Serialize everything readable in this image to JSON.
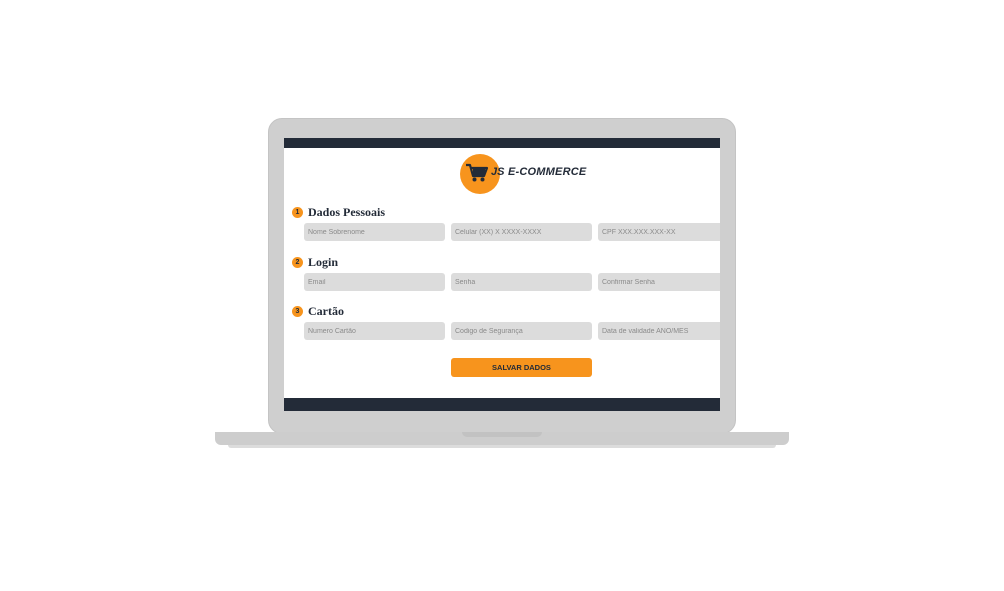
{
  "brand": {
    "js": "JS",
    "name": "E-COMMERCE"
  },
  "sections": [
    {
      "number": "1",
      "title": "Dados Pessoais",
      "fields": [
        {
          "placeholder": "Nome Sobrenome"
        },
        {
          "placeholder": "Celular (XX) X XXXX-XXXX"
        },
        {
          "placeholder": "CPF XXX.XXX.XXX-XX"
        }
      ]
    },
    {
      "number": "2",
      "title": "Login",
      "fields": [
        {
          "placeholder": "Email"
        },
        {
          "placeholder": "Senha"
        },
        {
          "placeholder": "Confirmar Senha"
        }
      ]
    },
    {
      "number": "3",
      "title": "Cartão",
      "fields": [
        {
          "placeholder": "Numero Cartão"
        },
        {
          "placeholder": "Codigo de Segurança"
        },
        {
          "placeholder": "Data de validade ANO/MES"
        }
      ]
    }
  ],
  "actions": {
    "save_label": "SALVAR DADOS"
  },
  "colors": {
    "accent": "#f7941d",
    "dark": "#232b38",
    "field_bg": "#dcdcdc",
    "laptop": "#cfcfcf"
  }
}
